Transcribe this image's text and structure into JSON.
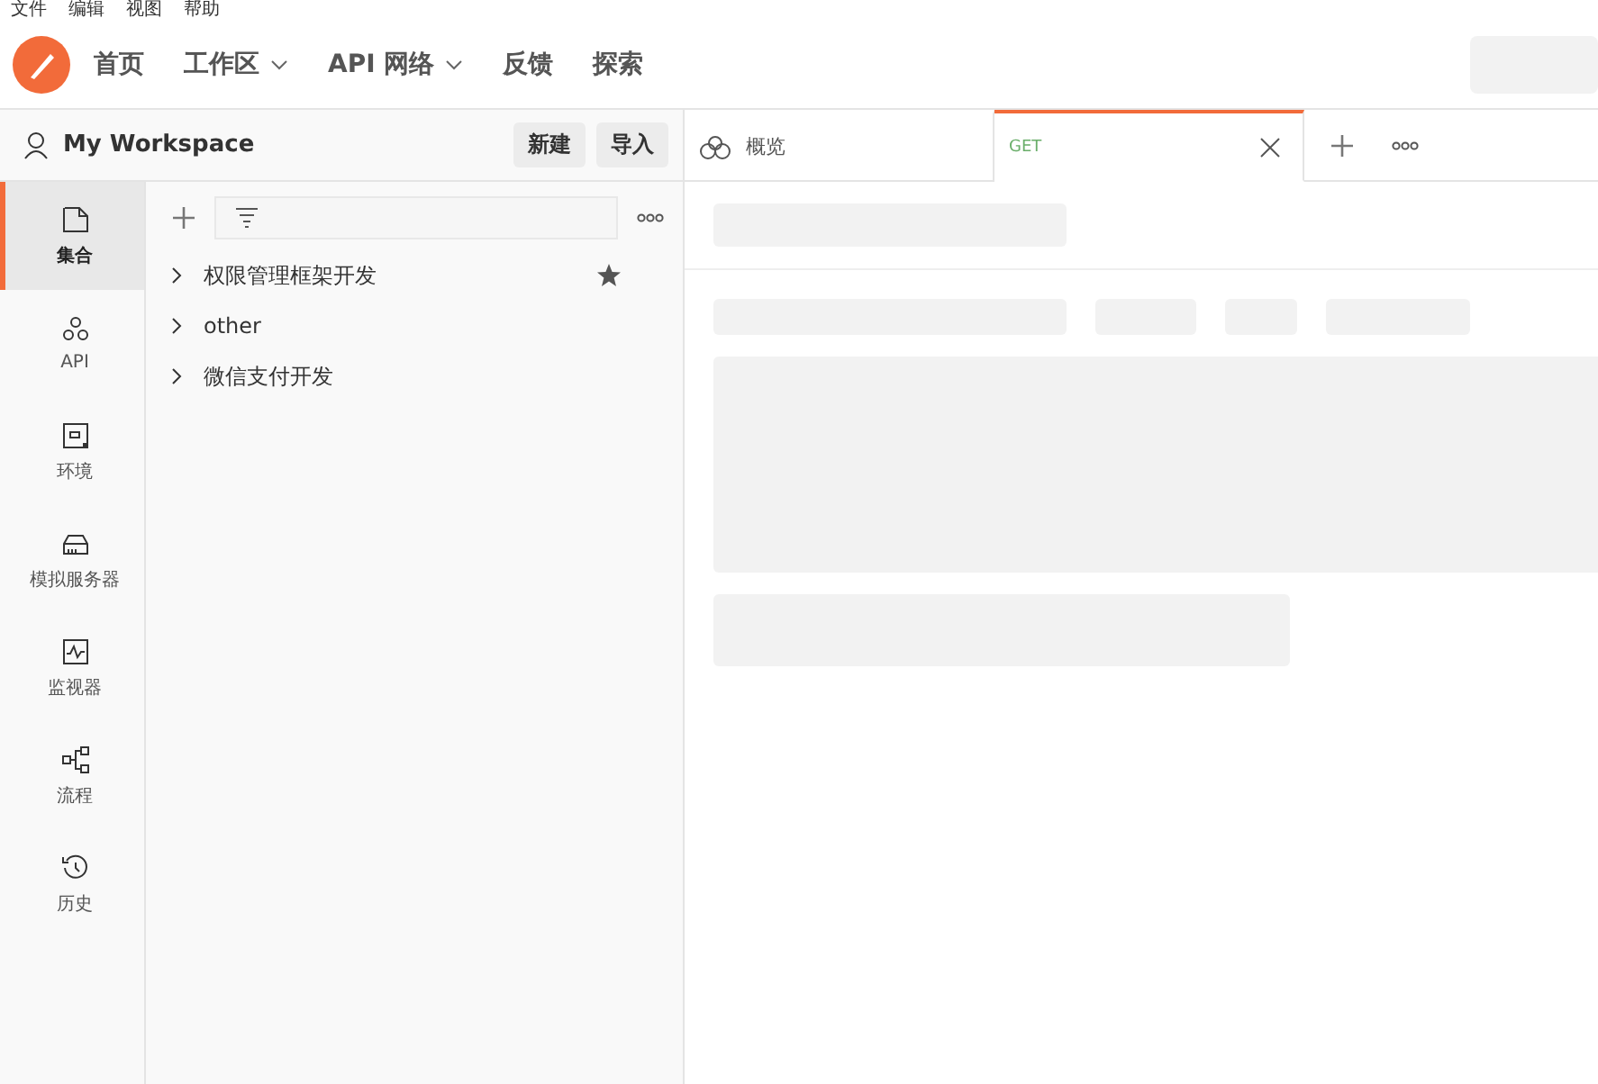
{
  "menu": [
    "文件",
    "编辑",
    "视图",
    "帮助"
  ],
  "nav": [
    {
      "label": "首页",
      "dropdown": false
    },
    {
      "label": "工作区",
      "dropdown": true
    },
    {
      "label": "API 网络",
      "dropdown": true
    },
    {
      "label": "反馈",
      "dropdown": false
    },
    {
      "label": "探索",
      "dropdown": false
    }
  ],
  "workspace": {
    "name": "My Workspace",
    "buttons": [
      "新建",
      "导入"
    ]
  },
  "rail": [
    {
      "kind": "collections",
      "label": "集合",
      "selected": true
    },
    {
      "kind": "api",
      "label": "API",
      "selected": false
    },
    {
      "kind": "environments",
      "label": "环境",
      "selected": false
    },
    {
      "kind": "mock",
      "label": "模拟服务器",
      "selected": false
    },
    {
      "kind": "monitors",
      "label": "监视器",
      "selected": false
    },
    {
      "kind": "flows",
      "label": "流程",
      "selected": false
    },
    {
      "kind": "history",
      "label": "历史",
      "selected": false
    }
  ],
  "collections": [
    {
      "name": "权限管理框架开发",
      "starred": true
    },
    {
      "name": "other",
      "starred": false
    },
    {
      "name": "微信支付开发",
      "starred": false
    }
  ],
  "tabs": [
    {
      "kind": "overview",
      "label": "概览",
      "selected": false
    },
    {
      "kind": "request",
      "label": "GET",
      "selected": true
    }
  ]
}
